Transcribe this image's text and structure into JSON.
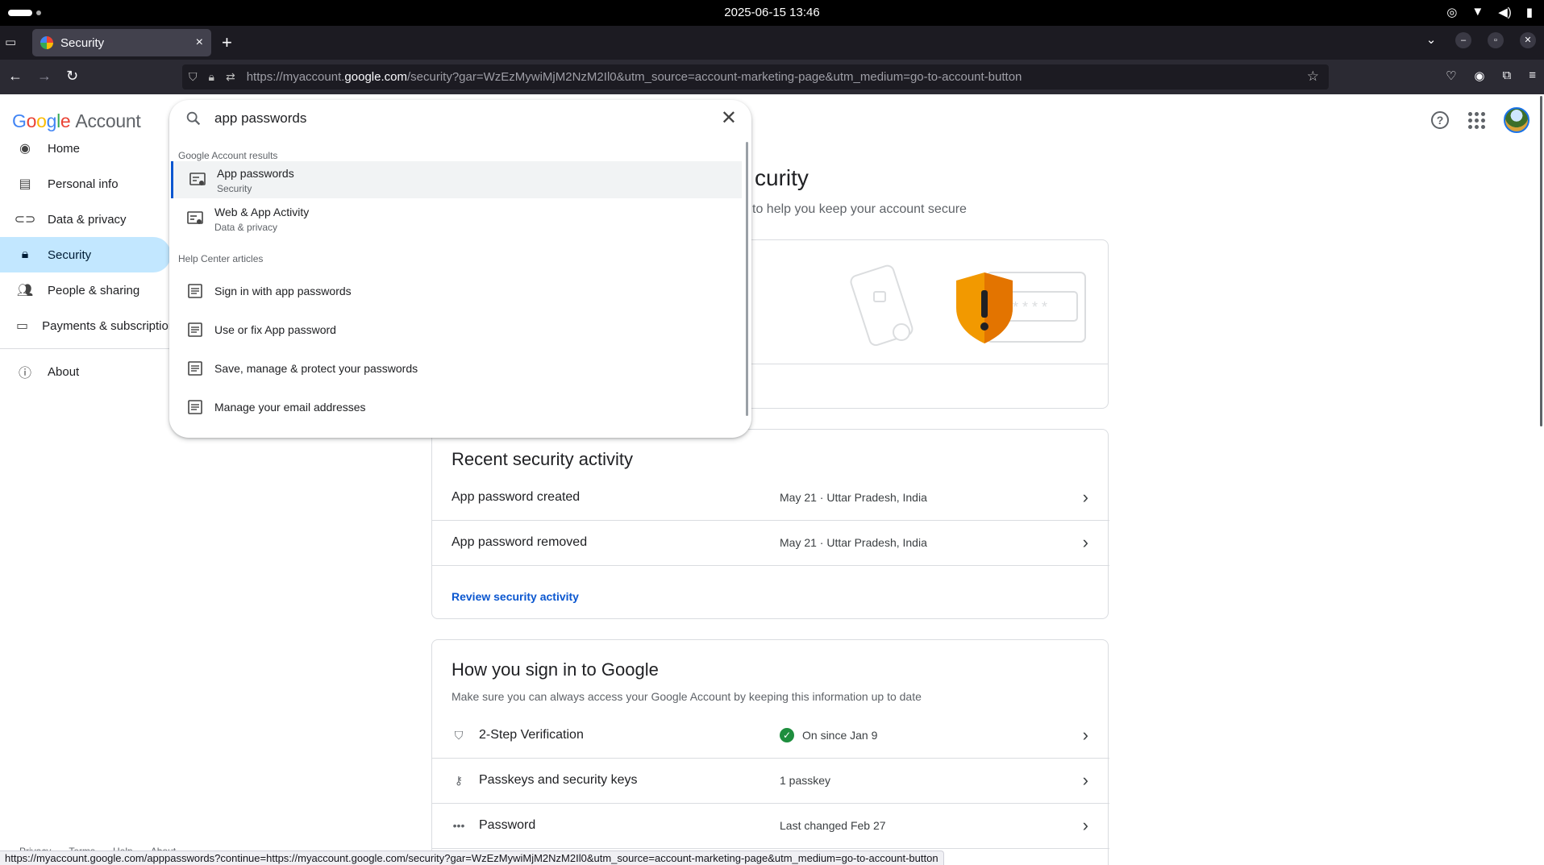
{
  "os": {
    "clock": "2025-06-15  13:46"
  },
  "browser": {
    "tab_title": "Security",
    "url_prefix": "https://myaccount.",
    "url_domain": "google.com",
    "url_suffix": "/security?gar=WzEzMywiMjM2NzM2Il0&utm_source=account-marketing-page&utm_medium=go-to-account-button",
    "status_url": "https://myaccount.google.com/apppasswords?continue=https://myaccount.google.com/security?gar=WzEzMywiMjM2NzM2Il0&utm_source=account-marketing-page&utm_medium=go-to-account-button"
  },
  "header": {
    "logo_g1": "G",
    "logo_g2": "o",
    "logo_g3": "o",
    "logo_g4": "g",
    "logo_g5": "l",
    "logo_g6": "e",
    "logo_suffix": "Account"
  },
  "sidebar": {
    "items": [
      {
        "label": "Home",
        "icon": "person-circle-icon"
      },
      {
        "label": "Personal info",
        "icon": "id-card-icon"
      },
      {
        "label": "Data & privacy",
        "icon": "toggle-icon"
      },
      {
        "label": "Security",
        "icon": "lock-icon"
      },
      {
        "label": "People & sharing",
        "icon": "people-icon"
      },
      {
        "label": "Payments & subscriptions",
        "icon": "credit-card-icon"
      },
      {
        "label": "About",
        "icon": "info-icon"
      }
    ]
  },
  "search": {
    "query": "app passwords",
    "account_results_label": "Google Account results",
    "account_results": [
      {
        "title": "App passwords",
        "subtitle": "Security"
      },
      {
        "title": "Web & App Activity",
        "subtitle": "Data & privacy"
      }
    ],
    "help_label": "Help Center articles",
    "help_results": [
      "Sign in with app passwords",
      "Use or fix App password",
      "Save, manage & protect your passwords",
      "Manage your email addresses"
    ]
  },
  "main": {
    "title_fragment": "curity",
    "subtitle_fragment": "to help you keep your account secure",
    "recent": {
      "title": "Recent security activity",
      "rows": [
        {
          "label": "App password created",
          "value": "May 21 · Uttar Pradesh, India"
        },
        {
          "label": "App password removed",
          "value": "May 21 · Uttar Pradesh, India"
        }
      ],
      "link": "Review security activity"
    },
    "signin": {
      "title": "How you sign in to Google",
      "subtitle": "Make sure you can always access your Google Account by keeping this information up to date",
      "rows": [
        {
          "label": "2-Step Verification",
          "value": "On since Jan 9",
          "icon": "shield-icon"
        },
        {
          "label": "Passkeys and security keys",
          "value": "1 passkey",
          "icon": "passkey-icon"
        },
        {
          "label": "Password",
          "value": "Last changed Feb 27",
          "icon": "password-dots-icon"
        }
      ]
    }
  },
  "footer": {
    "links": [
      "Privacy",
      "Terms",
      "Help",
      "About"
    ]
  }
}
